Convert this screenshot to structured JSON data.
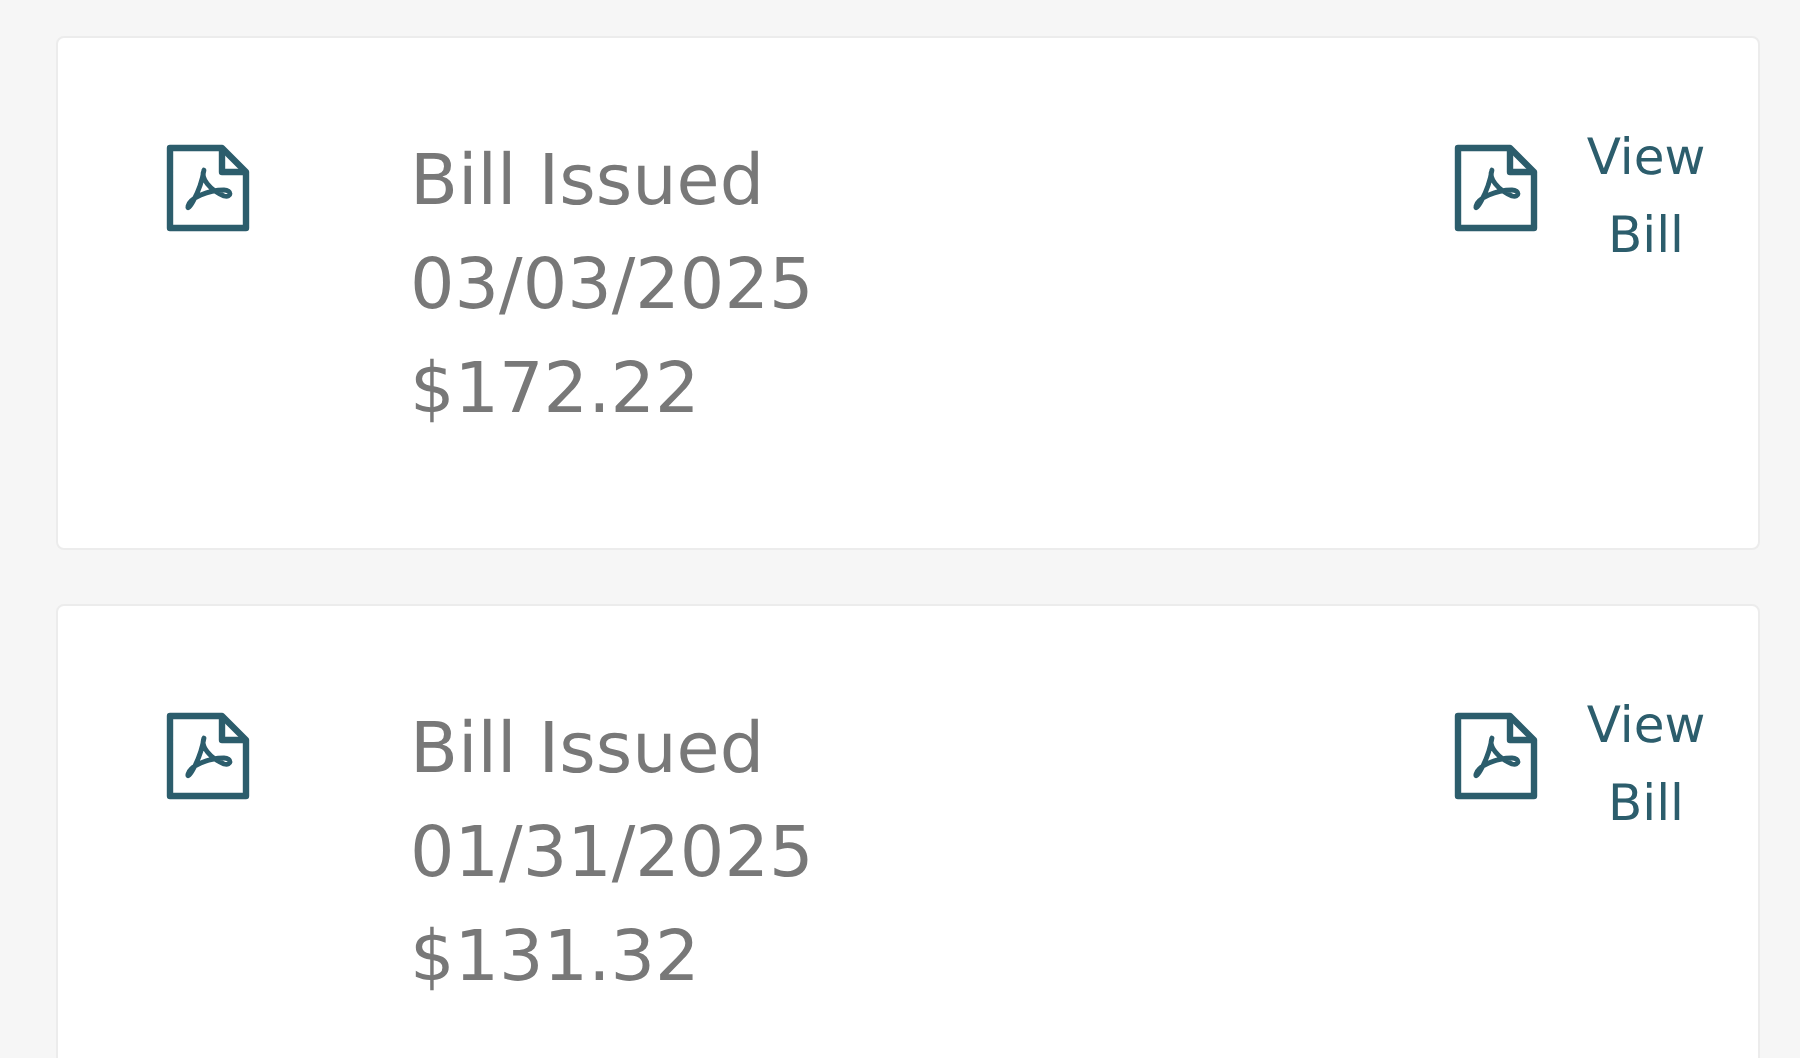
{
  "bills": [
    {
      "title": "Bill Issued",
      "date": "03/03/2025",
      "amount": "$172.22",
      "link": "View Bill"
    },
    {
      "title": "Bill Issued",
      "date": "01/31/2025",
      "amount": "$131.32",
      "link": "View Bill"
    }
  ]
}
